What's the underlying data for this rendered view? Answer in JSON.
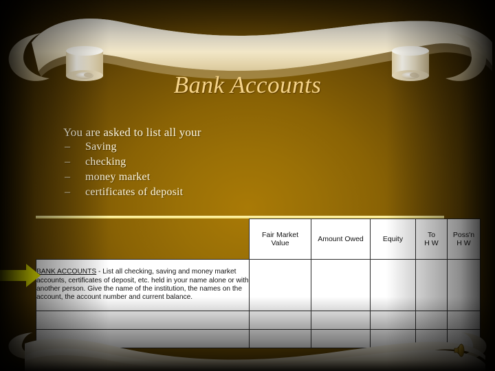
{
  "slide": {
    "title": "Bank Accounts",
    "background_color": "#8a6305",
    "title_color": "#f6d48a",
    "accent_rule_color": "#fff6b0"
  },
  "body": {
    "lead": "You are asked to list all your",
    "dash": "–",
    "items": [
      {
        "label": "Saving"
      },
      {
        "label": "checking"
      },
      {
        "label": "money market"
      },
      {
        "label": "certificates of deposit"
      }
    ]
  },
  "form_table": {
    "headers": [
      {
        "line1": "",
        "line2": ""
      },
      {
        "line1": "Fair Market",
        "line2": "Value"
      },
      {
        "line1": "Amount Owed",
        "line2": ""
      },
      {
        "line1": "Equity",
        "line2": ""
      },
      {
        "line1": "To",
        "line2": "H  W"
      },
      {
        "line1": "Poss'n",
        "line2": "H  W"
      }
    ],
    "description_row": {
      "label": "BANK ACCOUNTS",
      "text": " - List all checking, saving and money market accounts, certificates of deposit, etc. held in your name alone or with another person. Give the name of the institution, the names on the account, the account number and current balance."
    },
    "empty_row_count": 2
  },
  "annotations": {
    "arrow": "yellow-right-arrow",
    "speaker": "speaker-sound-icon"
  }
}
